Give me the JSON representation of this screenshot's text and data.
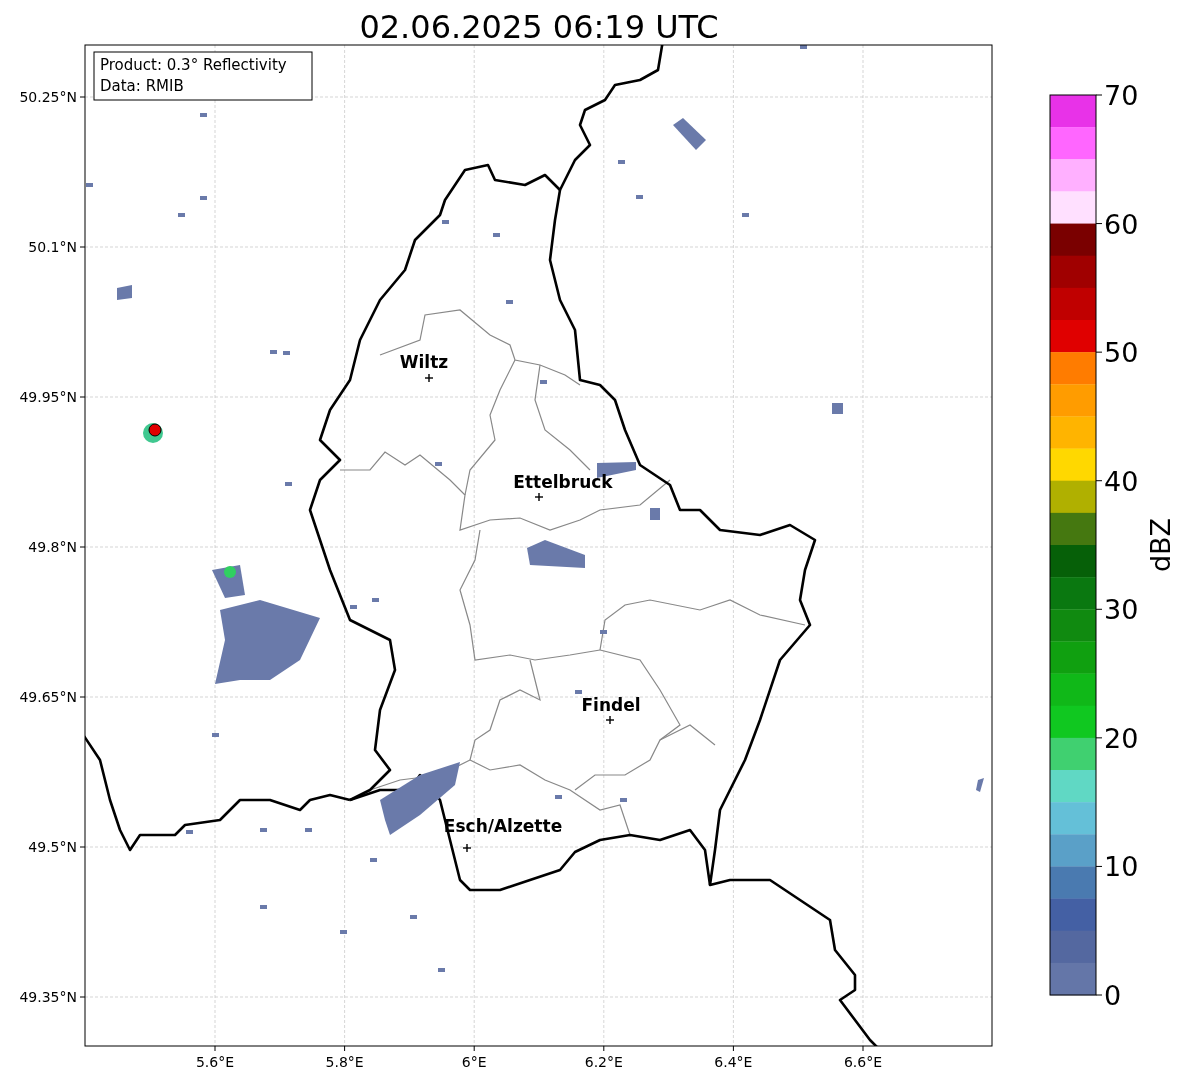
{
  "title": "02.06.2025 06:19 UTC",
  "info_box": [
    "Product: 0.3° Reflectivity",
    "Data: RMIB"
  ],
  "map": {
    "lon_ticks": [
      "5.6°E",
      "5.8°E",
      "6°E",
      "6.2°E",
      "6.4°E",
      "6.6°E"
    ],
    "lat_ticks": [
      "50.25°N",
      "50.1°N",
      "49.95°N",
      "49.8°N",
      "49.65°N",
      "49.5°N",
      "49.35°N"
    ],
    "places": [
      "Wiltz",
      "Ettelbruck",
      "Findel",
      "Esch/Alzette"
    ]
  },
  "colorbar": {
    "label": "dBZ",
    "ticks": [
      "70",
      "60",
      "50",
      "40",
      "30",
      "20",
      "10",
      "0"
    ],
    "segments": [
      {
        "color": "#e832e8"
      },
      {
        "color": "#ff66ff"
      },
      {
        "color": "#ffb0ff"
      },
      {
        "color": "#ffe0ff"
      },
      {
        "color": "#7a0000"
      },
      {
        "color": "#a00000"
      },
      {
        "color": "#c00000"
      },
      {
        "color": "#e00000"
      },
      {
        "color": "#ff7c00"
      },
      {
        "color": "#ff9c00"
      },
      {
        "color": "#ffb400"
      },
      {
        "color": "#ffd800"
      },
      {
        "color": "#b0b000"
      },
      {
        "color": "#457810"
      },
      {
        "color": "#066008"
      },
      {
        "color": "#0a7810"
      },
      {
        "color": "#108a10"
      },
      {
        "color": "#10a010"
      },
      {
        "color": "#10b818"
      },
      {
        "color": "#10c820"
      },
      {
        "color": "#40d070"
      },
      {
        "color": "#60d8c4"
      },
      {
        "color": "#64c0d8"
      },
      {
        "color": "#5aa0c8"
      },
      {
        "color": "#4a7ab0"
      },
      {
        "color": "#4460a4"
      },
      {
        "color": "#5468a0"
      },
      {
        "color": "#6476a8"
      }
    ]
  }
}
